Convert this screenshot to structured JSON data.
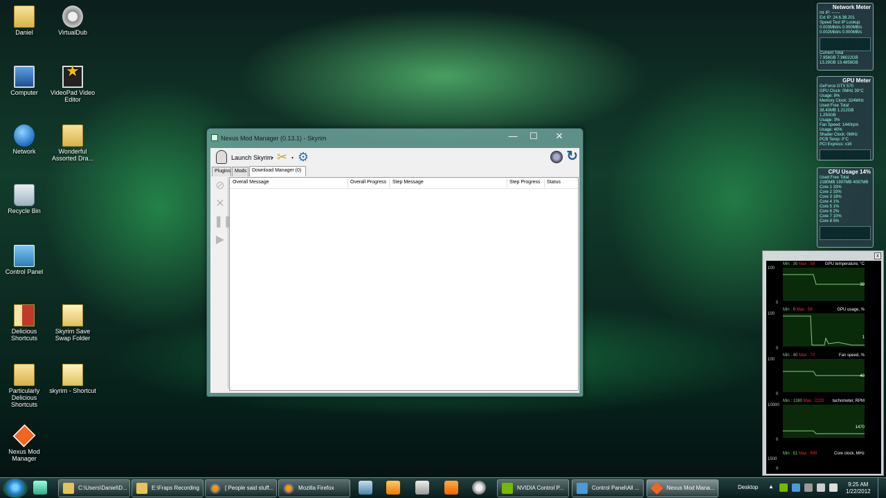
{
  "desktop": {
    "icons": [
      {
        "label": "Daniel",
        "icon": "folder-icon"
      },
      {
        "label": "VirtualDub",
        "icon": "gear-app-icon"
      },
      {
        "label": "Computer",
        "icon": "computer-icon"
      },
      {
        "label": "VideoPad Video Editor",
        "icon": "star-app-icon"
      },
      {
        "label": "Network",
        "icon": "network-icon"
      },
      {
        "label": "Wonderful Assorted Dra...",
        "icon": "folder-icon"
      },
      {
        "label": "Recycle Bin",
        "icon": "recycle-bin-icon"
      },
      {
        "label": "Control Panel",
        "icon": "control-panel-icon"
      },
      {
        "label": "Delicious Shortcuts",
        "icon": "shortcut-folder-icon"
      },
      {
        "label": "Skyrim Save Swap Folder",
        "icon": "shortcut-folder-icon"
      },
      {
        "label": "Particularly Delicious Shortcuts",
        "icon": "folder-icon"
      },
      {
        "label": "skyrim - Shortcut",
        "icon": "shortcut-folder-icon"
      },
      {
        "label": "Nexus Mod Manager",
        "icon": "nexus-icon"
      }
    ]
  },
  "gadgets": {
    "network": {
      "title": "Network Meter",
      "lines": [
        "Int IP: ------",
        "Ext IP: 24.6.38.201",
        "Speed Test    IP Lookup",
        "0.003Mbit/s    0.000MB/s",
        "0.002Mbit/s    0.000MB/s",
        "Current          Total",
        "7.956GB     7.96022GB",
        "13.29GB     13.4858GB"
      ]
    },
    "gpu": {
      "title": "GPU Meter",
      "lines": [
        "GeForce GTX 570",
        "GPU Clock: 0MHz        39°C",
        "Usage: 8%",
        "Memory Clock: 324MHz",
        "Used      Free      Total",
        "38.40MB  1.212GB  1.250GB",
        "Usage: 3%",
        "Fan Speed: 1440rpm",
        "Usage: 40%",
        "Shader Clock: 0MHz",
        "PCB Temp: 0°C",
        "PCI Express: x16"
      ]
    },
    "cpu": {
      "title": "CPU Usage  14%",
      "lines": [
        "Used      Free      Total",
        "2180MB  1907MB  4087MB",
        "Core 1   33%",
        "Core 2   33%",
        "Core 3   18%",
        "Core 4    1%",
        "Core 5    1%",
        "Core 6    2%",
        "Core 7   10%",
        "Core 8    5%"
      ]
    }
  },
  "hwmon": {
    "close": "x",
    "rows": [
      {
        "min": "Min : 30",
        "max": "Max : 59",
        "name": "GPU temperature, °C",
        "top": "100",
        "bottom": "0",
        "current": "39"
      },
      {
        "min": "Min : 0",
        "max": "Max : 59",
        "name": "GPU usage, %",
        "top": "100",
        "bottom": "0",
        "current": "1"
      },
      {
        "min": "Min : 40",
        "max": "Max : 70",
        "name": "Fan speed, %",
        "top": "100",
        "bottom": "0",
        "current": "40"
      },
      {
        "min": "Min : 1380",
        "max": "Max : 2220",
        "name": "tachometer, RPM",
        "top": "10000",
        "bottom": "0",
        "current": "1470"
      },
      {
        "min": "Min : 51",
        "max": "Max : 900",
        "name": "Core clock, MHz",
        "top": "1500",
        "bottom": "0",
        "current": ""
      }
    ]
  },
  "window": {
    "title": "Nexus Mod Manager (0.13.1) - Skyrim",
    "minimize": "—",
    "maximize": "☐",
    "close": "✕",
    "toolbar": {
      "launch_label": "Launch Skyrim",
      "dropdown_arrow": "▾",
      "tools_icon": "✂",
      "settings_icon": "⚙",
      "refresh_icon": "↻"
    },
    "tabs": [
      "Plugins",
      "Mods",
      "Download Manager (0)"
    ],
    "active_tab": "Download Manager (0)",
    "side_tools": [
      "⊘",
      "✕",
      "❚❚",
      "▶"
    ],
    "columns": [
      "Overall Message",
      "Overall Progress",
      "Step Message",
      "Step Progress",
      "Status"
    ]
  },
  "taskbar": {
    "items": [
      {
        "label": "C:\\Users\\Daniel\\D...",
        "icon": "folder-icon"
      },
      {
        "label": "E:\\Fraps Recording",
        "icon": "folder-icon"
      },
      {
        "label": "[ People said stuff...",
        "icon": "firefox-icon"
      },
      {
        "label": "Mozilla Firefox",
        "icon": "firefox-icon"
      },
      {
        "label": "NVIDIA Control P...",
        "icon": "nvidia-icon"
      },
      {
        "label": "Control Panel\\All ...",
        "icon": "control-panel-icon"
      },
      {
        "label": "Nexus Mod Mana...",
        "icon": "nexus-icon"
      }
    ],
    "desktop_label": "Desktop",
    "tray_arrow": "▲",
    "time": "9:25 AM",
    "date": "1/22/2012"
  },
  "colors": {
    "accent": "#2b7ed0",
    "nexus": "#f26522",
    "monitor_green": "#7d7",
    "monitor_red": "#e33"
  }
}
